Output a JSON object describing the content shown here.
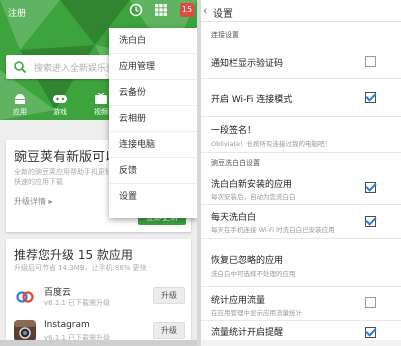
{
  "left": {
    "header": {
      "register_link": "注册",
      "notification_badge": "15"
    },
    "search": {
      "placeholder": "搜索进入全新娱乐资讯"
    },
    "categories": [
      {
        "label": "应用",
        "icon": "android-icon"
      },
      {
        "label": "游戏",
        "icon": "gamepad-icon"
      },
      {
        "label": "视频",
        "icon": "tv-icon"
      }
    ],
    "update_card": {
      "title": "豌豆荚有新版可以升级",
      "description": "全新的豌豆荚应用帮助手机更轻松，新增应用市场更安全快速的应用下载",
      "details_label": "升级详情 ▸",
      "update_button": "立即更新"
    },
    "recommend_card": {
      "title": "推荐您升级 15 款应用",
      "subtitle": "升级后可节省 14.3MB，让手机 86% 更快"
    },
    "apps": [
      {
        "name": "百度云",
        "version": "v6.1.1 已下载需升级",
        "button": "升级",
        "icon": "baidu-cloud-icon"
      },
      {
        "name": "Instagram",
        "version": "v6.1.1 已下载需升级",
        "button": "升级",
        "icon": "instagram-icon"
      }
    ],
    "menu": [
      "洗白白",
      "应用管理",
      "云备份",
      "云相册",
      "连接电脑",
      "反馈",
      "设置"
    ],
    "colors": {
      "brand_green": "#3da33d",
      "badge_red": "#e24a3b"
    }
  },
  "right": {
    "title": "设置",
    "sections": [
      {
        "header": "连接设置",
        "rows": [
          {
            "label": "通知栏显示验证码",
            "sublabel": "",
            "checked": false
          },
          {
            "label": "开启 Wi-Fi 连接模式",
            "sublabel": "",
            "checked": true
          },
          {
            "label": "一段签名！",
            "sublabel": "Obliviate！长按所有连接过我的电脑吧！",
            "checked": null
          }
        ]
      },
      {
        "header": "豌豆洗白白设置",
        "rows": [
          {
            "label": "洗白白新安装的应用",
            "sublabel": "每次安装后，自动为您洗白白",
            "checked": true
          },
          {
            "label": "每天洗白白",
            "sublabel": "每天在手机连接 Wi-Fi 时洗白白已安装应用",
            "checked": true
          },
          {
            "label": "恢复已忽略的应用",
            "sublabel": "洗白白中可选择不处理的应用",
            "checked": null
          },
          {
            "label": "统计应用流量",
            "sublabel": "在应用管理中显示应用流量统计",
            "checked": false
          },
          {
            "label": "流量统计开启提醒",
            "sublabel": "",
            "checked": true
          }
        ]
      }
    ],
    "colors": {
      "check_blue": "#2e7bd6"
    }
  }
}
